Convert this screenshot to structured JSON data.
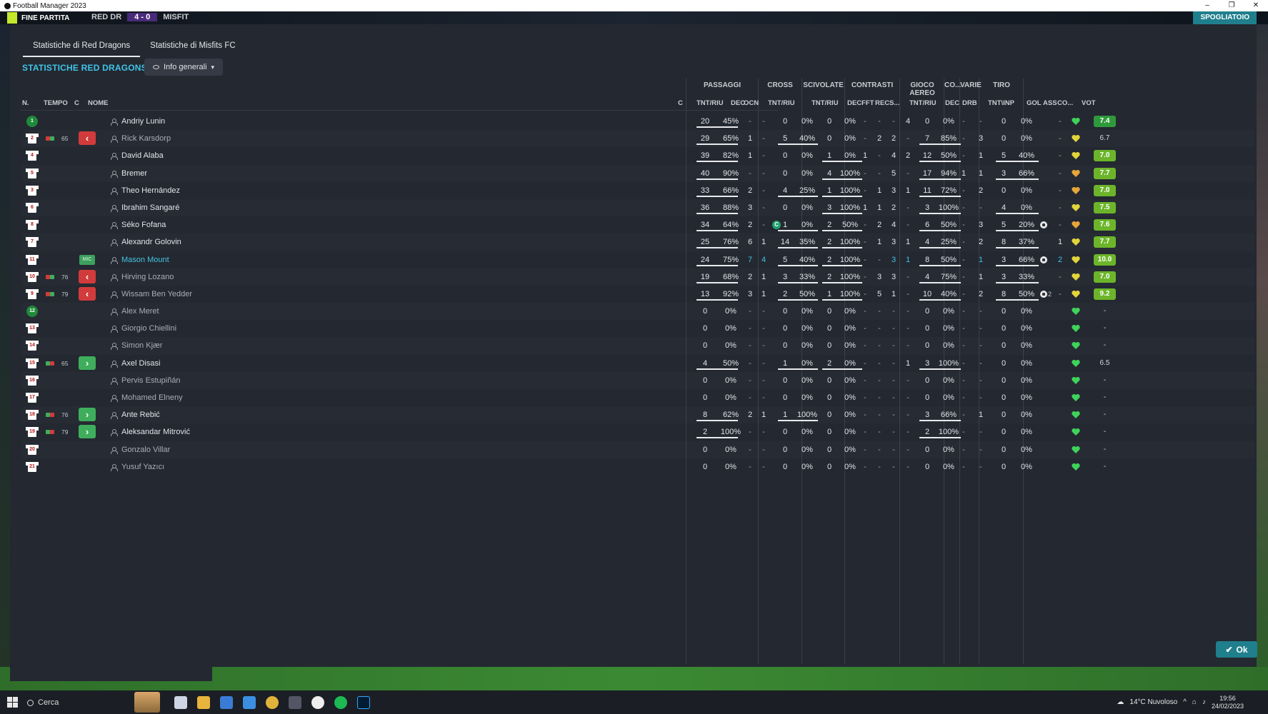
{
  "window": {
    "title": "Football Manager 2023",
    "controls": [
      "–",
      "❐",
      "✕"
    ]
  },
  "gamebar": {
    "finish_label": "FINE PARTITA",
    "home": "RED DR",
    "score": "4 - 0",
    "away": "MISFIT",
    "dressing_room": "SPOGLIATOIO"
  },
  "tabs": [
    "Statistiche di Red Dragons",
    "Statistiche di Misfits FC"
  ],
  "section_title": "STATISTICHE RED DRAGONS",
  "info_button": "Info generali",
  "group_headers": [
    "PASSAGGI",
    "CROSS",
    "SCIVOLATE",
    "CONTRASTI",
    "GIOCO AEREO",
    "CO...",
    "VARIE",
    "TIRO"
  ],
  "column_headers": {
    "n": "N.",
    "tempo": "TEMPO",
    "c": "C",
    "nome": "NOME",
    "c2": "C",
    "pass_tr": "TNT/RIU",
    "pass_dec": "DEC",
    "pass_ocn": "OCN",
    "cross_tr": "TNT/RIU",
    "sciv_tr": "TNT/RIU",
    "con_dec": "DEC",
    "con_fft": "FFT",
    "con_rec": "REC",
    "con_s": "S...",
    "aer_tr": "TNT/RIU",
    "co_dec": "DEC",
    "var_drb": "DRB",
    "tiro": "TNT\\INP",
    "gol": "GOL",
    "ass": "ASS",
    "cond": "CO...",
    "vot": "VOT"
  },
  "players": [
    {
      "num": "1",
      "gk": true,
      "name": "Andriy Lunin",
      "style": "normal",
      "sub": null,
      "pass": [
        "20",
        "45%"
      ],
      "dec": "-",
      "ocn": "-",
      "cross": [
        "0",
        "0%"
      ],
      "sciv": [
        "0",
        "0%"
      ],
      "con": [
        "-",
        "-",
        "-",
        "4"
      ],
      "aer": [
        "0",
        "0%"
      ],
      "codec": "-",
      "drb": "-",
      "tiro": [
        "0",
        "0%"
      ],
      "gol": "",
      "ass": "-",
      "heart": "green",
      "vot": "7.4",
      "votstyle": "green",
      "cap": false
    },
    {
      "num": "2",
      "gk": false,
      "name": "Rick Karsdorp",
      "style": "dim",
      "sub": {
        "type": "out",
        "min": "65"
      },
      "pass": [
        "29",
        "65%"
      ],
      "dec": "1",
      "ocn": "-",
      "cross": [
        "5",
        "40%"
      ],
      "sciv": [
        "0",
        "0%"
      ],
      "con": [
        "-",
        "2",
        "2",
        "-"
      ],
      "aer": [
        "7",
        "85%"
      ],
      "codec": "-",
      "drb": "3",
      "tiro": [
        "0",
        "0%"
      ],
      "gol": "",
      "ass": "-",
      "heart": "yellow",
      "vot": "6.7",
      "votstyle": "plain",
      "cap": false
    },
    {
      "num": "4",
      "gk": false,
      "name": "David Alaba",
      "style": "normal",
      "sub": null,
      "pass": [
        "39",
        "82%"
      ],
      "dec": "1",
      "ocn": "-",
      "cross": [
        "0",
        "0%"
      ],
      "sciv": [
        "1",
        "0%"
      ],
      "con": [
        "1",
        "-",
        "4",
        "2"
      ],
      "aer": [
        "12",
        "50%"
      ],
      "codec": "-",
      "drb": "1",
      "tiro": [
        "5",
        "40%"
      ],
      "gol": "",
      "ass": "-",
      "heart": "yellow",
      "vot": "7.0",
      "votstyle": "lime",
      "cap": false
    },
    {
      "num": "5",
      "gk": false,
      "name": "Bremer",
      "style": "normal",
      "sub": null,
      "pass": [
        "40",
        "90%"
      ],
      "dec": "-",
      "ocn": "-",
      "cross": [
        "0",
        "0%"
      ],
      "sciv": [
        "4",
        "100%"
      ],
      "con": [
        "-",
        "-",
        "5",
        "-"
      ],
      "aer": [
        "17",
        "94%"
      ],
      "codec": "1",
      "drb": "1",
      "tiro": [
        "3",
        "66%"
      ],
      "gol": "",
      "ass": "-",
      "heart": "orange",
      "vot": "7.7",
      "votstyle": "lime",
      "cap": false
    },
    {
      "num": "3",
      "gk": false,
      "name": "Theo Hernández",
      "style": "normal",
      "sub": null,
      "pass": [
        "33",
        "66%"
      ],
      "dec": "2",
      "ocn": "-",
      "cross": [
        "4",
        "25%"
      ],
      "sciv": [
        "1",
        "100%"
      ],
      "con": [
        "-",
        "1",
        "3",
        "1"
      ],
      "aer": [
        "11",
        "72%"
      ],
      "codec": "-",
      "drb": "2",
      "tiro": [
        "0",
        "0%"
      ],
      "gol": "",
      "ass": "-",
      "heart": "orange",
      "vot": "7.0",
      "votstyle": "lime",
      "cap": false
    },
    {
      "num": "6",
      "gk": false,
      "name": "Ibrahim Sangaré",
      "style": "normal",
      "sub": null,
      "pass": [
        "36",
        "88%"
      ],
      "dec": "3",
      "ocn": "-",
      "cross": [
        "0",
        "0%"
      ],
      "sciv": [
        "3",
        "100%"
      ],
      "con": [
        "1",
        "1",
        "2",
        "-"
      ],
      "aer": [
        "3",
        "100%"
      ],
      "codec": "-",
      "drb": "-",
      "tiro": [
        "4",
        "0%"
      ],
      "gol": "",
      "ass": "-",
      "heart": "yellow",
      "vot": "7.5",
      "votstyle": "lime",
      "cap": false
    },
    {
      "num": "8",
      "gk": false,
      "name": "Séko Fofana",
      "style": "normal",
      "sub": null,
      "pass": [
        "34",
        "64%"
      ],
      "dec": "2",
      "ocn": "-",
      "cross": [
        "1",
        "0%"
      ],
      "sciv": [
        "2",
        "50%"
      ],
      "con": [
        "-",
        "2",
        "4",
        "-"
      ],
      "aer": [
        "6",
        "50%"
      ],
      "codec": "-",
      "drb": "3",
      "tiro": [
        "5",
        "20%"
      ],
      "gol": "ball",
      "ass": "-",
      "heart": "orange",
      "vot": "7.6",
      "votstyle": "lime",
      "cap": true
    },
    {
      "num": "7",
      "gk": false,
      "name": "Alexandr Golovin",
      "style": "normal",
      "sub": null,
      "pass": [
        "25",
        "76%"
      ],
      "dec": "6",
      "ocn": "1",
      "cross": [
        "14",
        "35%"
      ],
      "sciv": [
        "2",
        "100%"
      ],
      "con": [
        "-",
        "1",
        "3",
        "1"
      ],
      "aer": [
        "4",
        "25%"
      ],
      "codec": "-",
      "drb": "2",
      "tiro": [
        "8",
        "37%"
      ],
      "gol": "",
      "ass": "1",
      "heart": "yellow",
      "vot": "7.7",
      "votstyle": "lime",
      "cap": false
    },
    {
      "num": "11",
      "gk": false,
      "name": "Mason Mount",
      "style": "hl",
      "sub": {
        "type": "mic"
      },
      "pass": [
        "24",
        "75%"
      ],
      "dec": "7",
      "ocn": "4",
      "cross": [
        "5",
        "40%"
      ],
      "sciv": [
        "2",
        "100%"
      ],
      "con": [
        "-",
        "-",
        "3",
        "1"
      ],
      "aer": [
        "8",
        "50%"
      ],
      "codec": "-",
      "drb": "1",
      "tiro": [
        "3",
        "66%"
      ],
      "gol": "ball",
      "ass": "2",
      "heart": "yellow",
      "vot": "10.0",
      "votstyle": "lime",
      "cap": false,
      "teal": true
    },
    {
      "num": "10",
      "gk": false,
      "name": "Hirving Lozano",
      "style": "dim",
      "sub": {
        "type": "out",
        "min": "76"
      },
      "pass": [
        "19",
        "68%"
      ],
      "dec": "2",
      "ocn": "1",
      "cross": [
        "3",
        "33%"
      ],
      "sciv": [
        "2",
        "100%"
      ],
      "con": [
        "-",
        "3",
        "3",
        "-"
      ],
      "aer": [
        "4",
        "75%"
      ],
      "codec": "-",
      "drb": "1",
      "tiro": [
        "3",
        "33%"
      ],
      "gol": "",
      "ass": "-",
      "heart": "yellow",
      "vot": "7.0",
      "votstyle": "lime",
      "cap": false
    },
    {
      "num": "9",
      "gk": false,
      "name": "Wissam Ben Yedder",
      "style": "dim",
      "sub": {
        "type": "out",
        "min": "79"
      },
      "pass": [
        "13",
        "92%"
      ],
      "dec": "3",
      "ocn": "1",
      "cross": [
        "2",
        "50%"
      ],
      "sciv": [
        "1",
        "100%"
      ],
      "con": [
        "-",
        "5",
        "1",
        "-"
      ],
      "aer": [
        "10",
        "40%"
      ],
      "codec": "-",
      "drb": "2",
      "tiro": [
        "8",
        "50%"
      ],
      "gol": "ball2",
      "ass": "-",
      "heart": "yellow",
      "vot": "9.2",
      "votstyle": "lime",
      "cap": false
    },
    {
      "num": "12",
      "gk": true,
      "name": "Alex Meret",
      "style": "dim",
      "sub": null,
      "pass": [
        "0",
        "0%"
      ],
      "dec": "-",
      "ocn": "-",
      "cross": [
        "0",
        "0%"
      ],
      "sciv": [
        "0",
        "0%"
      ],
      "con": [
        "-",
        "-",
        "-",
        "-"
      ],
      "aer": [
        "0",
        "0%"
      ],
      "codec": "-",
      "drb": "-",
      "tiro": [
        "0",
        "0%"
      ],
      "gol": "",
      "ass": "",
      "heart": "green",
      "vot": "-",
      "votstyle": "plain",
      "cap": false
    },
    {
      "num": "13",
      "gk": false,
      "name": "Giorgio Chiellini",
      "style": "dim",
      "sub": null,
      "pass": [
        "0",
        "0%"
      ],
      "dec": "-",
      "ocn": "-",
      "cross": [
        "0",
        "0%"
      ],
      "sciv": [
        "0",
        "0%"
      ],
      "con": [
        "-",
        "-",
        "-",
        "-"
      ],
      "aer": [
        "0",
        "0%"
      ],
      "codec": "-",
      "drb": "-",
      "tiro": [
        "0",
        "0%"
      ],
      "gol": "",
      "ass": "",
      "heart": "green",
      "vot": "-",
      "votstyle": "plain",
      "cap": false
    },
    {
      "num": "14",
      "gk": false,
      "name": "Simon Kjær",
      "style": "dim",
      "sub": null,
      "pass": [
        "0",
        "0%"
      ],
      "dec": "-",
      "ocn": "-",
      "cross": [
        "0",
        "0%"
      ],
      "sciv": [
        "0",
        "0%"
      ],
      "con": [
        "-",
        "-",
        "-",
        "-"
      ],
      "aer": [
        "0",
        "0%"
      ],
      "codec": "-",
      "drb": "-",
      "tiro": [
        "0",
        "0%"
      ],
      "gol": "",
      "ass": "",
      "heart": "green",
      "vot": "-",
      "votstyle": "plain",
      "cap": false
    },
    {
      "num": "15",
      "gk": false,
      "name": "Axel Disasi",
      "style": "normal",
      "sub": {
        "type": "in",
        "min": "65"
      },
      "pass": [
        "4",
        "50%"
      ],
      "dec": "-",
      "ocn": "-",
      "cross": [
        "1",
        "0%"
      ],
      "sciv": [
        "2",
        "0%"
      ],
      "con": [
        "-",
        "-",
        "-",
        "1"
      ],
      "aer": [
        "3",
        "100%"
      ],
      "codec": "-",
      "drb": "-",
      "tiro": [
        "0",
        "0%"
      ],
      "gol": "",
      "ass": "",
      "heart": "green",
      "vot": "6.5",
      "votstyle": "plain",
      "cap": false
    },
    {
      "num": "16",
      "gk": false,
      "name": "Pervis Estupiñán",
      "style": "dim",
      "sub": null,
      "pass": [
        "0",
        "0%"
      ],
      "dec": "-",
      "ocn": "-",
      "cross": [
        "0",
        "0%"
      ],
      "sciv": [
        "0",
        "0%"
      ],
      "con": [
        "-",
        "-",
        "-",
        "-"
      ],
      "aer": [
        "0",
        "0%"
      ],
      "codec": "-",
      "drb": "-",
      "tiro": [
        "0",
        "0%"
      ],
      "gol": "",
      "ass": "",
      "heart": "green",
      "vot": "-",
      "votstyle": "plain",
      "cap": false
    },
    {
      "num": "17",
      "gk": false,
      "name": "Mohamed Elneny",
      "style": "dim",
      "sub": null,
      "pass": [
        "0",
        "0%"
      ],
      "dec": "-",
      "ocn": "-",
      "cross": [
        "0",
        "0%"
      ],
      "sciv": [
        "0",
        "0%"
      ],
      "con": [
        "-",
        "-",
        "-",
        "-"
      ],
      "aer": [
        "0",
        "0%"
      ],
      "codec": "-",
      "drb": "-",
      "tiro": [
        "0",
        "0%"
      ],
      "gol": "",
      "ass": "",
      "heart": "green",
      "vot": "-",
      "votstyle": "plain",
      "cap": false
    },
    {
      "num": "18",
      "gk": false,
      "name": "Ante Rebić",
      "style": "normal",
      "sub": {
        "type": "in",
        "min": "76"
      },
      "pass": [
        "8",
        "62%"
      ],
      "dec": "2",
      "ocn": "1",
      "cross": [
        "1",
        "100%"
      ],
      "sciv": [
        "0",
        "0%"
      ],
      "con": [
        "-",
        "-",
        "-",
        "-"
      ],
      "aer": [
        "3",
        "66%"
      ],
      "codec": "-",
      "drb": "1",
      "tiro": [
        "0",
        "0%"
      ],
      "gol": "",
      "ass": "",
      "heart": "green",
      "vot": "-",
      "votstyle": "plain",
      "cap": false
    },
    {
      "num": "19",
      "gk": false,
      "name": "Aleksandar Mitrović",
      "style": "normal",
      "sub": {
        "type": "in",
        "min": "79"
      },
      "pass": [
        "2",
        "100%"
      ],
      "dec": "-",
      "ocn": "-",
      "cross": [
        "0",
        "0%"
      ],
      "sciv": [
        "0",
        "0%"
      ],
      "con": [
        "-",
        "-",
        "-",
        "-"
      ],
      "aer": [
        "2",
        "100%"
      ],
      "codec": "-",
      "drb": "-",
      "tiro": [
        "0",
        "0%"
      ],
      "gol": "",
      "ass": "",
      "heart": "green",
      "vot": "-",
      "votstyle": "plain",
      "cap": false
    },
    {
      "num": "20",
      "gk": false,
      "name": "Gonzalo Villar",
      "style": "dim",
      "sub": null,
      "pass": [
        "0",
        "0%"
      ],
      "dec": "-",
      "ocn": "-",
      "cross": [
        "0",
        "0%"
      ],
      "sciv": [
        "0",
        "0%"
      ],
      "con": [
        "-",
        "-",
        "-",
        "-"
      ],
      "aer": [
        "0",
        "0%"
      ],
      "codec": "-",
      "drb": "-",
      "tiro": [
        "0",
        "0%"
      ],
      "gol": "",
      "ass": "",
      "heart": "green",
      "vot": "-",
      "votstyle": "plain",
      "cap": false
    },
    {
      "num": "21",
      "gk": false,
      "name": "Yusuf Yazıcı",
      "style": "dim",
      "sub": null,
      "pass": [
        "0",
        "0%"
      ],
      "dec": "-",
      "ocn": "-",
      "cross": [
        "0",
        "0%"
      ],
      "sciv": [
        "0",
        "0%"
      ],
      "con": [
        "-",
        "-",
        "-",
        "-"
      ],
      "aer": [
        "0",
        "0%"
      ],
      "codec": "-",
      "drb": "-",
      "tiro": [
        "0",
        "0%"
      ],
      "gol": "",
      "ass": "",
      "heart": "green",
      "vot": "-",
      "votstyle": "plain",
      "cap": false
    }
  ],
  "captain_label": "C",
  "mic_label": "MIC",
  "ok_button": "Ok",
  "taskbar": {
    "search_label": "Cerca",
    "weather": "14°C Nuvoloso",
    "time": "19:56",
    "date": "24/02/2023"
  },
  "colors": {
    "accent": "#3fc4e8",
    "panel": "#242831",
    "vote_green": "#2f9a3b",
    "vote_lime": "#6cb52a",
    "sub_out": "#d23b3b",
    "sub_in": "#3fae5c"
  }
}
